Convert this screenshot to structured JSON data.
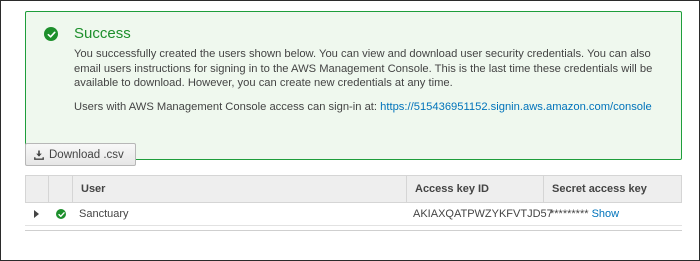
{
  "alert": {
    "title": "Success",
    "body": "You successfully created the users shown below. You can view and download user security credentials. You can also email users instructions for signing in to the AWS Management Console. This is the last time these credentials will be available to download. However, you can create new credentials at any time.",
    "signin_prefix": "Users with AWS Management Console access can sign-in at:",
    "signin_url": "https://515436951152.signin.aws.amazon.com/console",
    "icon": "check-circle-icon",
    "color": "#1d8f2c"
  },
  "toolbar": {
    "download_label": "Download .csv",
    "download_icon": "download-icon"
  },
  "table": {
    "columns": [
      "User",
      "Access key ID",
      "Secret access key"
    ],
    "rows": [
      {
        "user": "Sanctuary",
        "access_key_id": "AKIAXQATPWZYKFVTJD57",
        "secret_masked": "*********",
        "show_label": "Show",
        "status_icon": "check-circle-icon"
      }
    ]
  },
  "link_color": "#0073bb"
}
